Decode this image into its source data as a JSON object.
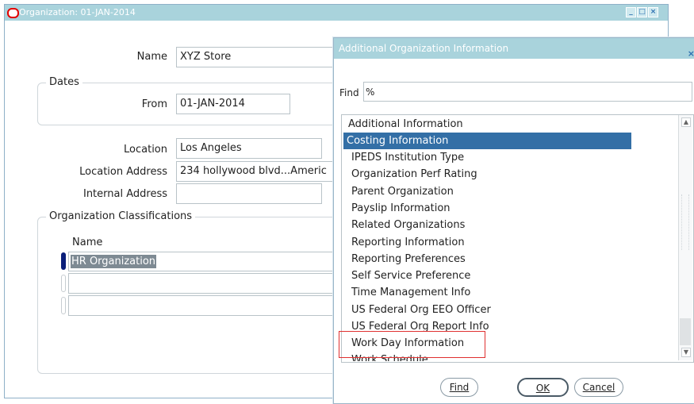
{
  "main_window": {
    "title": "Organization: 01-JAN-2014",
    "name_label": "Name",
    "name_value": "XYZ Store",
    "dates_group": "Dates",
    "from_label": "From",
    "from_value": "01-JAN-2014",
    "location_label": "Location",
    "location_value": "Los Angeles",
    "location_address_label": "Location Address",
    "location_address_value": "234 hollywood blvd...Americ",
    "internal_address_label": "Internal Address",
    "internal_address_value": "",
    "classifications_group": "Organization Classifications",
    "classifications_name_header": "Name",
    "classifications_rows": [
      "HR Organization",
      "",
      ""
    ]
  },
  "dialog": {
    "title": "Additional Organization Information",
    "find_label": "Find",
    "find_value": "%",
    "list_header": "Additional Information",
    "items": [
      "Costing Information",
      "IPEDS Institution Type",
      "Organization Perf Rating",
      "Parent Organization",
      "Payslip Information",
      "Related Organizations",
      "Reporting Information",
      "Reporting Preferences",
      "Self Service Preference",
      "Time Management Info",
      "US Federal Org EEO Officer",
      "US Federal Org Report Info",
      "Work Day Information",
      "Work Schedule"
    ],
    "selected_item": "Costing Information",
    "highlighted_item": "Work Day Information",
    "buttons": {
      "find": "Find",
      "ok": "OK",
      "cancel": "Cancel"
    }
  },
  "colors": {
    "title_bar": "#a9d3dc",
    "selection": "#336fa6",
    "highlight_box": "#e03030",
    "indicator": "#0b1f7a"
  }
}
